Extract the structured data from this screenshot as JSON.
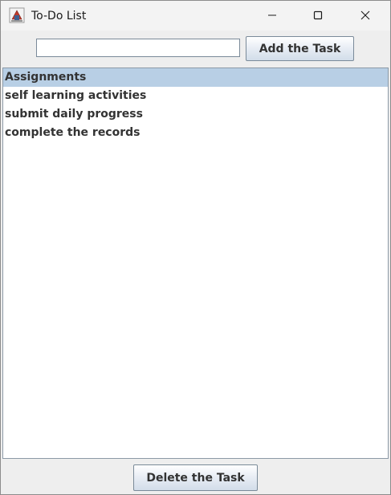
{
  "window": {
    "title": "To-Do List",
    "icon": "java-app-icon",
    "controls": {
      "minimize": "minimize-icon",
      "maximize": "maximize-icon",
      "close": "close-icon"
    }
  },
  "toolbar": {
    "task_input_value": "",
    "add_button_label": "Add the Task"
  },
  "tasks": {
    "items": [
      {
        "label": "Assignments",
        "selected": true
      },
      {
        "label": "self learning activities",
        "selected": false
      },
      {
        "label": "submit daily progress",
        "selected": false
      },
      {
        "label": "complete the records",
        "selected": false
      }
    ]
  },
  "footer": {
    "delete_button_label": "Delete the Task"
  },
  "colors": {
    "selection": "#b8cfe5",
    "text": "#333333",
    "window_bg": "#eeeeee"
  }
}
